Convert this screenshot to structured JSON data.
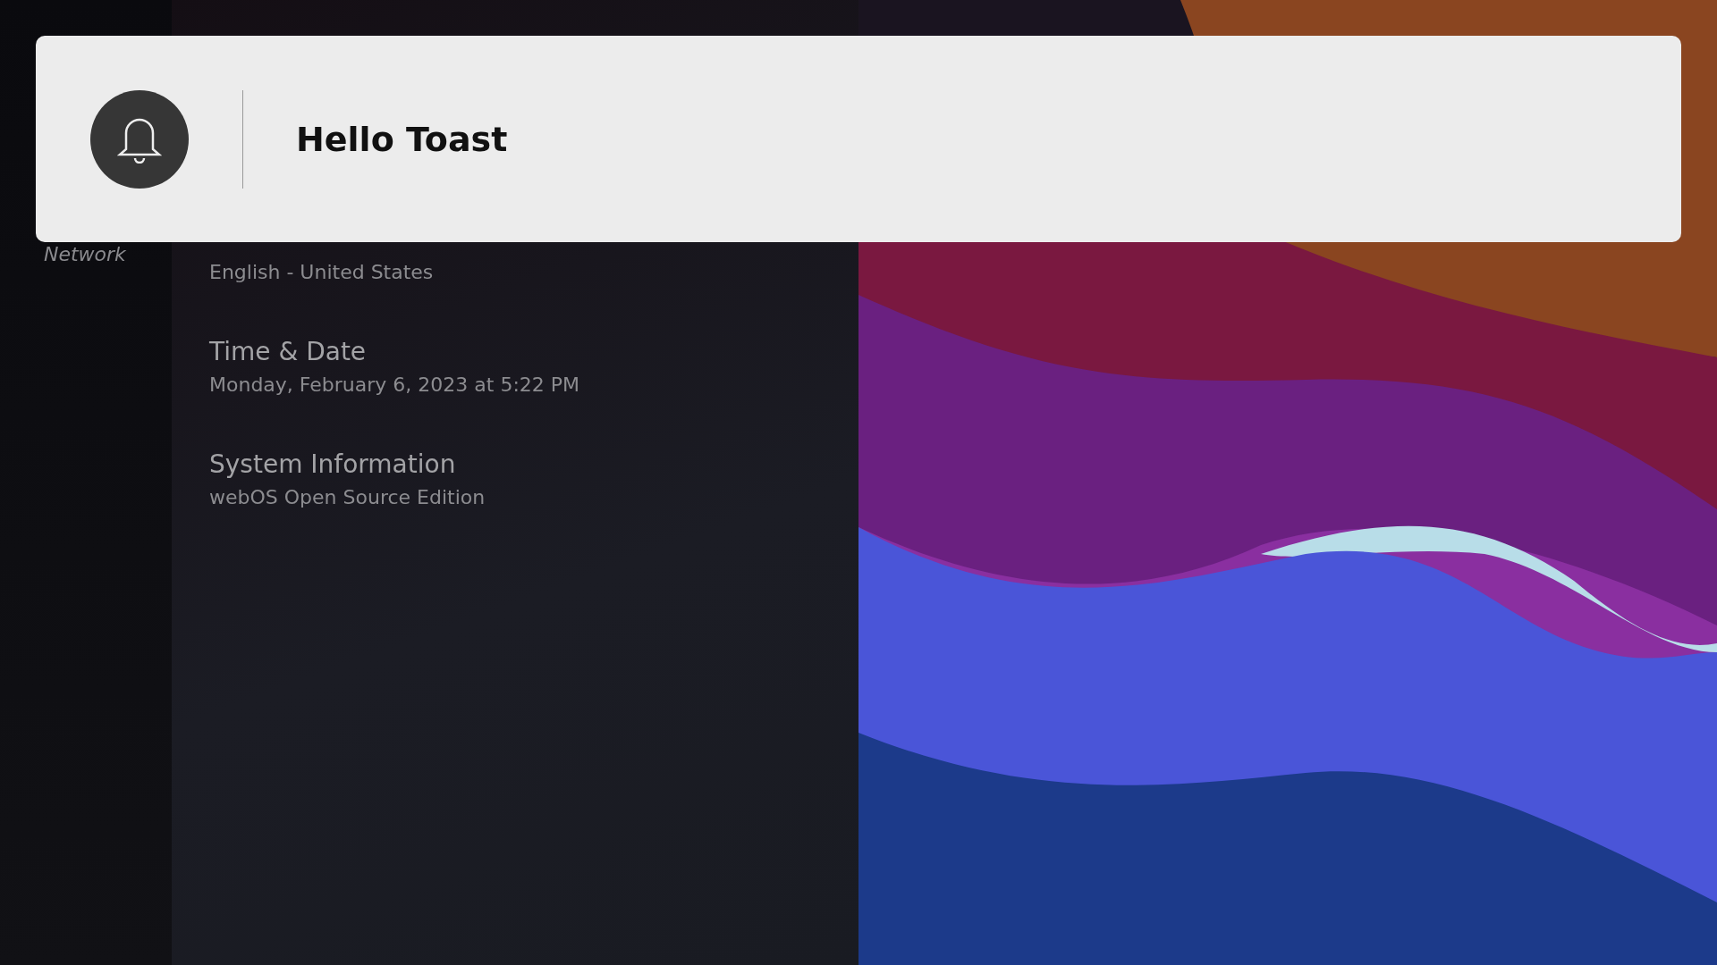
{
  "sidebar": {
    "items": [
      {
        "label": "Network"
      }
    ]
  },
  "settings": {
    "items": [
      {
        "subtitle": "English - United States"
      },
      {
        "title": "Time & Date",
        "subtitle": "Monday, February 6, 2023 at 5:22 PM"
      },
      {
        "title": "System Information",
        "subtitle": "webOS Open Source Edition"
      }
    ]
  },
  "toast": {
    "message": "Hello Toast"
  }
}
